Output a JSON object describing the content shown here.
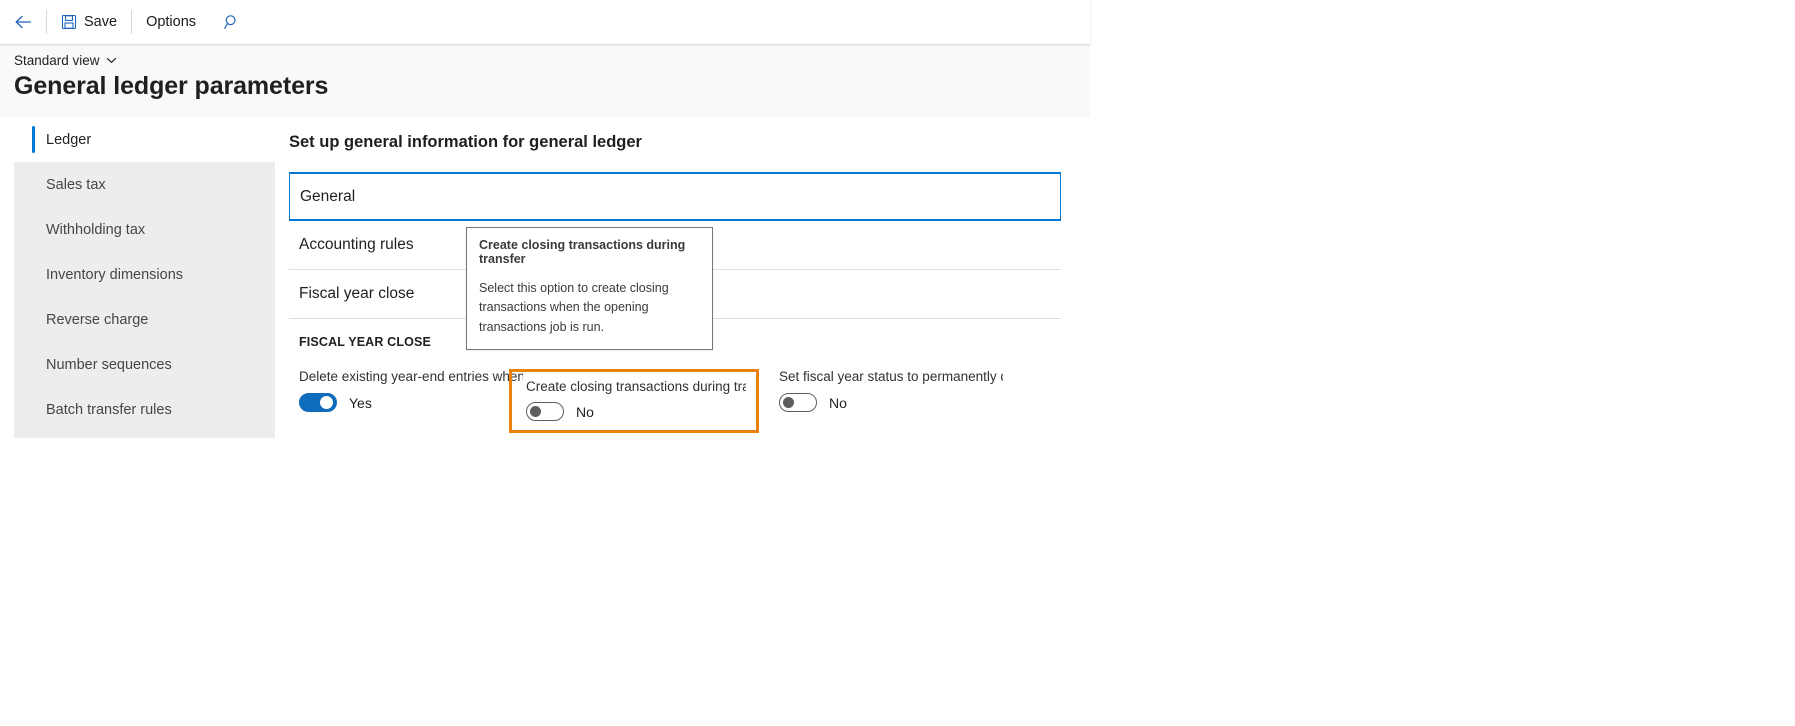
{
  "commandbar": {
    "back_icon": "arrow-left-icon",
    "save_label": "Save",
    "save_icon": "save-floppy-icon",
    "options_label": "Options",
    "search_icon": "search-icon"
  },
  "header": {
    "view_label": "Standard view",
    "view_chevron_icon": "chevron-down-icon",
    "title": "General ledger parameters"
  },
  "sidebar": {
    "items": [
      {
        "label": "Ledger",
        "selected": true
      },
      {
        "label": "Sales tax",
        "selected": false
      },
      {
        "label": "Withholding tax",
        "selected": false
      },
      {
        "label": "Inventory dimensions",
        "selected": false
      },
      {
        "label": "Reverse charge",
        "selected": false
      },
      {
        "label": "Number sequences",
        "selected": false
      },
      {
        "label": "Batch transfer rules",
        "selected": false
      }
    ]
  },
  "main": {
    "heading": "Set up general information for general ledger",
    "fasttabs": [
      {
        "title": "General",
        "expanded": true
      },
      {
        "title": "Accounting rules",
        "expanded": false
      },
      {
        "title": "Fiscal year close",
        "expanded": false
      }
    ],
    "fiscal_year_close": {
      "group_title": "FISCAL YEAR CLOSE",
      "fields": [
        {
          "label": "Delete existing year-end entries when ...",
          "value": "Yes",
          "state": "on",
          "highlighted": false
        },
        {
          "label": "Create closing transactions during tra...",
          "value": "No",
          "state": "off",
          "highlighted": true
        },
        {
          "label": "Set fiscal year status to permanently cl...",
          "value": "No",
          "state": "off",
          "highlighted": false
        }
      ]
    }
  },
  "tooltip": {
    "title": "Create closing transactions during transfer",
    "body": "Select this option to create closing transactions when the opening transactions job is run."
  },
  "colors": {
    "accent_blue": "#0078d4",
    "toggle_on_blue": "#0f6cbd",
    "highlight_orange": "#e8820c",
    "sidebar_bg": "#ededed",
    "header_bg": "#faf9f8"
  }
}
